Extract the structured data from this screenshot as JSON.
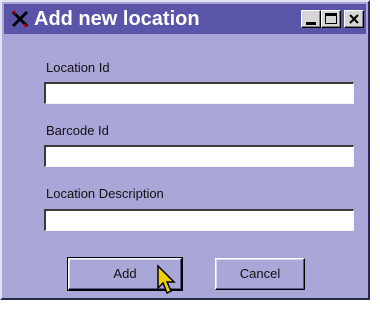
{
  "window": {
    "title": "Add new location",
    "controls": [
      "minimize",
      "maximize",
      "close"
    ]
  },
  "form": {
    "location_id_label": "Location Id",
    "location_id_value": "",
    "barcode_id_label": "Barcode Id",
    "barcode_id_value": "",
    "location_description_label": "Location Description",
    "location_description_value": ""
  },
  "buttons": {
    "add_label": "Add",
    "cancel_label": "Cancel"
  },
  "colors": {
    "titlebar": "#5a55a8",
    "window_bg": "#a9a6d8"
  },
  "icons": {
    "app": "crossed-tools-icon",
    "cursor": "mouse-pointer-icon"
  }
}
